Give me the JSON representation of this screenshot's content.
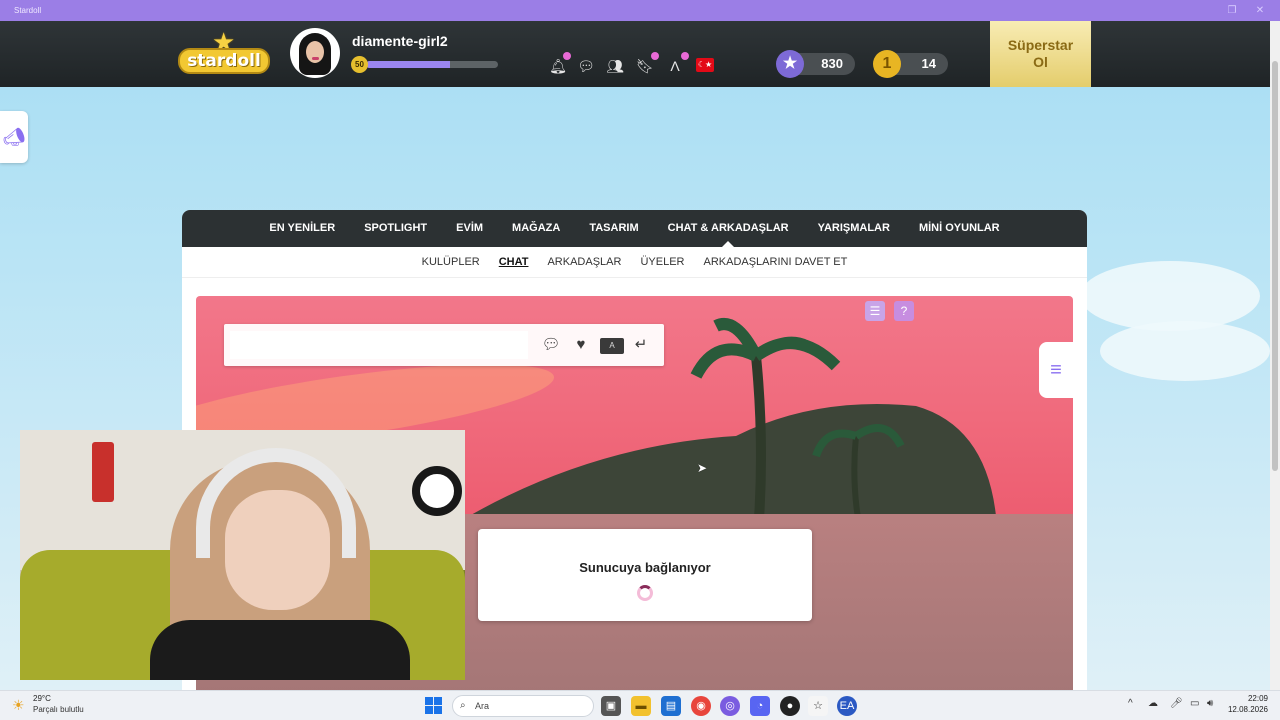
{
  "window": {
    "title": "Stardoll"
  },
  "header": {
    "logo": "stardoll",
    "username": "diamente-girl2",
    "level": "50",
    "level_progress": 0.64,
    "stardollars": "830",
    "coins": "14",
    "superstar_label": "Süperstar Ol",
    "icons": [
      "bell-icon",
      "chat-bubble-icon",
      "friends-icon",
      "bookmark-icon",
      "fashion-icon",
      "turkey-flag-icon"
    ],
    "flag_symbol": "☾★"
  },
  "main_nav": [
    {
      "label": "EN YENİLER",
      "active": false
    },
    {
      "label": "SPOTLIGHT",
      "active": false
    },
    {
      "label": "EVİM",
      "active": false
    },
    {
      "label": "MAĞAZA",
      "active": false
    },
    {
      "label": "TASARIM",
      "active": false
    },
    {
      "label": "CHAT & ARKADAŞLAR",
      "active": true
    },
    {
      "label": "YARIŞMALAR",
      "active": false
    },
    {
      "label": "MİNİ OYUNLAR",
      "active": false
    }
  ],
  "sub_nav": [
    {
      "label": "KULÜPLER",
      "active": false
    },
    {
      "label": "CHAT",
      "active": true
    },
    {
      "label": "ARKADAŞLAR",
      "active": false
    },
    {
      "label": "ÜYELER",
      "active": false
    },
    {
      "label": "ARKADAŞLARINI DAVET ET",
      "active": false
    }
  ],
  "chat": {
    "input_value": "",
    "input_placeholder": "",
    "buttons": [
      "speech-bubble-icon",
      "heart-icon",
      "keyboard-icon",
      "enter-icon"
    ],
    "keyboard_label": "A",
    "loading_text": "Sunucuya bağlanıyor"
  },
  "taskbar": {
    "temperature": "29°C",
    "weather": "Parçalı bulutlu",
    "search_placeholder": "Ara",
    "time": "22:09",
    "date": "12.08.2026"
  },
  "colors": {
    "accent": "#9b7ee6",
    "header_bg": "#2c3133",
    "scene_sky": "#ec5a6e",
    "superstar_bg": "#f1df8e"
  }
}
